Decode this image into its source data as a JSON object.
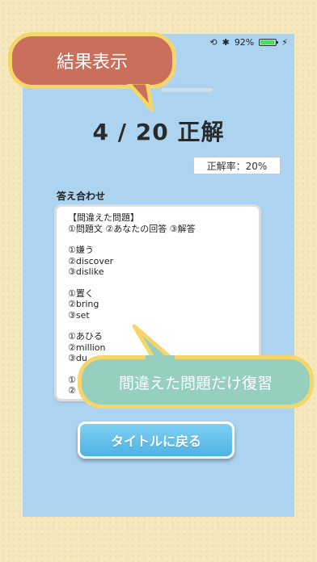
{
  "status": {
    "battery_text": "92%",
    "battery_level": 0.92
  },
  "result": {
    "score": "4 / 20 正解",
    "rate": "正解率：20%"
  },
  "answers": {
    "label": "答え合わせ",
    "lines": [
      "【間違えた問題】",
      "①問題文 ②あなたの回答 ③解答",
      "",
      "①嫌う",
      "②discover",
      "③dislike",
      "",
      "①置く",
      "②bring",
      "③set",
      "",
      "①あひる",
      "②million",
      "③du",
      "",
      "①",
      "②"
    ]
  },
  "buttons": {
    "title": "タイトルに戻る"
  },
  "callouts": {
    "top": "結果表示",
    "bottom": "間違えた問題だけ復習"
  },
  "colors": {
    "background": "#f6e8bd",
    "phone": "#acd3f0",
    "callout_top": "#c96f5b",
    "callout_bottom": "#97cfbe",
    "callout_border": "#f5d66a",
    "button": "#4db2e4"
  }
}
